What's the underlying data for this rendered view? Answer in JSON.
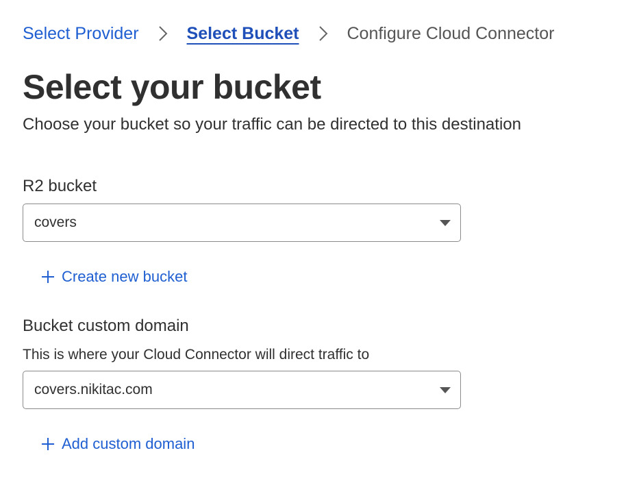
{
  "breadcrumb": {
    "step1": "Select Provider",
    "step2": "Select Bucket",
    "step3": "Configure Cloud Connector"
  },
  "header": {
    "title": "Select your bucket",
    "subtitle": "Choose your bucket so your traffic can be directed to this destination"
  },
  "bucket": {
    "label": "R2 bucket",
    "selected": "covers",
    "create_label": "Create new bucket"
  },
  "domain": {
    "label": "Bucket custom domain",
    "description": "This is where your Cloud Connector will direct traffic to",
    "selected": "covers.nikitac.com",
    "add_label": "Add custom domain"
  },
  "colors": {
    "link": "#1f5fd1",
    "text": "#303030",
    "border": "#8a8a8a"
  }
}
